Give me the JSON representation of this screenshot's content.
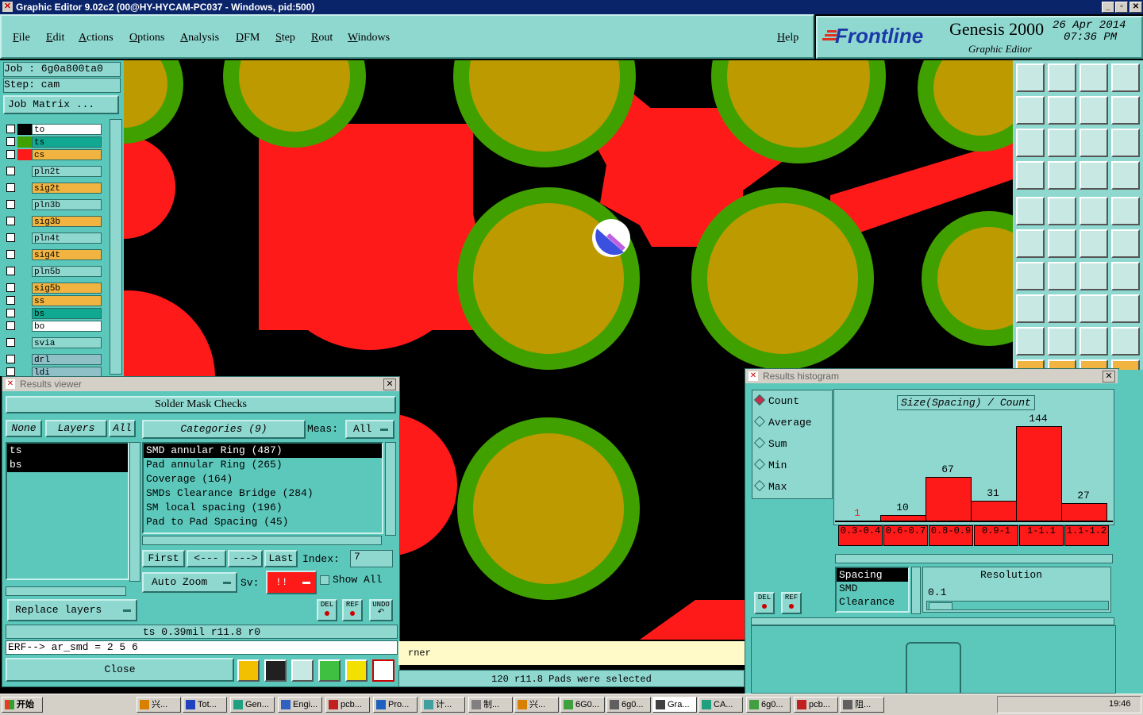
{
  "titlebar": {
    "title": "Graphic Editor 9.02c2 (00@HY-HYCAM-PC037 - Windows, pid:500)"
  },
  "menu": {
    "file": "File",
    "edit": "Edit",
    "actions": "Actions",
    "options": "Options",
    "analysis": "Analysis",
    "dfm": "DFM",
    "step": "Step",
    "rout": "Rout",
    "windows": "Windows",
    "help": "Help"
  },
  "brand": {
    "logo": "Frontline",
    "product": "Genesis 2000",
    "subtitle": "Graphic Editor",
    "date": "26 Apr 2014",
    "time": "07:36 PM"
  },
  "left": {
    "job": "Job  : 6g0a800ta0",
    "step": "Step: cam",
    "job_matrix": "Job Matrix ...",
    "layers": [
      {
        "name": "to",
        "color": "#000000",
        "bg": "#ffffff"
      },
      {
        "name": "ts",
        "color": "#40a000",
        "bg": "#10a890"
      },
      {
        "name": "cs",
        "color": "#ff1a1a",
        "bg": "#f2b440"
      },
      {
        "name": "pln2t",
        "color": "#5cc8bc",
        "bg": "#8fd8d0"
      },
      {
        "name": "sig2t",
        "color": "#5cc8bc",
        "bg": "#f2b440"
      },
      {
        "name": "pln3b",
        "color": "#5cc8bc",
        "bg": "#8fd8d0"
      },
      {
        "name": "sig3b",
        "color": "#5cc8bc",
        "bg": "#f2b440"
      },
      {
        "name": "pln4t",
        "color": "#5cc8bc",
        "bg": "#8fd8d0"
      },
      {
        "name": "sig4t",
        "color": "#5cc8bc",
        "bg": "#f2b440"
      },
      {
        "name": "pln5b",
        "color": "#5cc8bc",
        "bg": "#8fd8d0"
      },
      {
        "name": "sig5b",
        "color": "#5cc8bc",
        "bg": "#f2b440"
      },
      {
        "name": "ss",
        "color": "#5cc8bc",
        "bg": "#f2b440"
      },
      {
        "name": "bs",
        "color": "#5cc8bc",
        "bg": "#10a890"
      },
      {
        "name": "bo",
        "color": "#5cc8bc",
        "bg": "#ffffff"
      },
      {
        "name": "svia",
        "color": "#5cc8bc",
        "bg": "#8fd8d0"
      },
      {
        "name": "drl",
        "color": "#5cc8bc",
        "bg": "#8fc0c8"
      },
      {
        "name": "ldi",
        "color": "#5cc8bc",
        "bg": "#8fc0c8"
      }
    ]
  },
  "results_viewer": {
    "title": "Results viewer",
    "header": "Solder Mask Checks",
    "none_btn": "None",
    "layers_btn": "Layers",
    "all_btn": "All",
    "categories_btn": "Categories (9)",
    "meas_label": "Meas:",
    "meas_value": "All",
    "layer_list": [
      "ts",
      "bs"
    ],
    "categories": [
      "SMD annular Ring (487)",
      "Pad annular Ring (265)",
      "Coverage (164)",
      "SMDs Clearance Bridge (284)",
      "SM local spacing (196)",
      "Pad to Pad Spacing (45)"
    ],
    "first": "First",
    "prev": "<---",
    "next": "--->",
    "last": "Last",
    "index_label": "Index:",
    "index_value": "7",
    "auto_zoom": "Auto Zoom",
    "sv_label": "Sv:",
    "sv_value": "!!",
    "show_all": "Show All",
    "replace_layers": "Replace layers",
    "del": "DEL",
    "ref": "REF",
    "undo": "UNDO",
    "status": "ts 0.39mil  r11.8  r0",
    "erf": "ERF--> ar_smd = 2 5 6",
    "close": "Close"
  },
  "status_bar": {
    "message": "120 r11.8 Pads were selected",
    "partial": "rner"
  },
  "histogram": {
    "title": "Results histogram",
    "modes": [
      "Count",
      "Average",
      "Sum",
      "Min",
      "Max"
    ],
    "selected_mode": "Count",
    "chart_title": "Size(Spacing) / Count",
    "del": "DEL",
    "ref": "REF",
    "list": [
      "Spacing",
      "SMD",
      "Clearance"
    ],
    "resolution_label": "Resolution",
    "resolution_value": "0.1"
  },
  "chart_data": {
    "type": "bar",
    "title": "Size(Spacing) / Count",
    "categories": [
      "0.3-0.4",
      "0.6-0.7",
      "0.8-0.9",
      "0.9-1",
      "1-1.1",
      "1.1-1.2"
    ],
    "values": [
      1,
      10,
      67,
      31,
      144,
      27
    ],
    "ylim": [
      0,
      144
    ]
  },
  "taskbar": {
    "start": "开始",
    "tasks": [
      "兴...",
      "Tot...",
      "Gen...",
      "Engi...",
      "pcb...",
      "Pro...",
      "计...",
      "制...",
      "兴...",
      "6G0...",
      "6g0...",
      "Gra...",
      "CA...",
      "6g0...",
      "pcb...",
      "阻..."
    ],
    "clock": "19:46"
  }
}
